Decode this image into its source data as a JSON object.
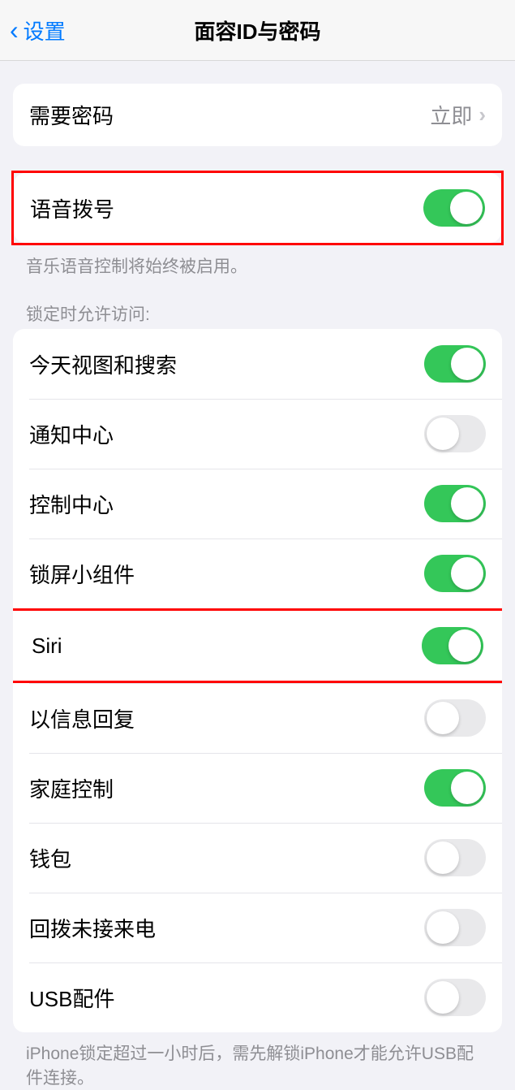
{
  "header": {
    "back_label": "设置",
    "title": "面容ID与密码"
  },
  "passcode_row": {
    "label": "需要密码",
    "value": "立即"
  },
  "voice_dial": {
    "label": "语音拨号",
    "on": true,
    "footer": "音乐语音控制将始终被启用。"
  },
  "lock_access": {
    "header": "锁定时允许访问:",
    "items": [
      {
        "label": "今天视图和搜索",
        "on": true
      },
      {
        "label": "通知中心",
        "on": false
      },
      {
        "label": "控制中心",
        "on": true
      },
      {
        "label": "锁屏小组件",
        "on": true
      },
      {
        "label": "Siri",
        "on": true,
        "highlighted": true
      },
      {
        "label": "以信息回复",
        "on": false
      },
      {
        "label": "家庭控制",
        "on": true
      },
      {
        "label": "钱包",
        "on": false
      },
      {
        "label": "回拨未接来电",
        "on": false
      },
      {
        "label": "USB配件",
        "on": false
      }
    ],
    "footer": "iPhone锁定超过一小时后，需先解锁iPhone才能允许USB配件连接。"
  }
}
